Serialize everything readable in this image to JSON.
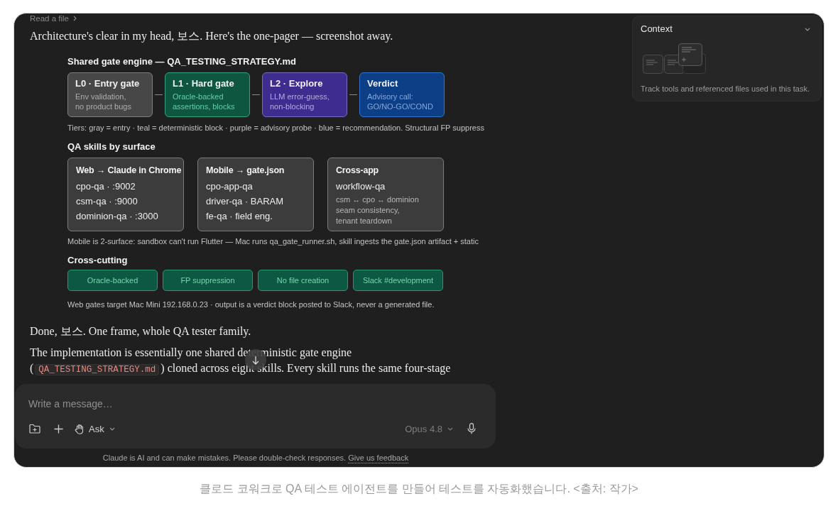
{
  "tool_use": {
    "label": "Read a file"
  },
  "intro": "Architecture's clear in my head, 보스. Here's the one-pager — screenshot away.",
  "diagram": {
    "sections": [
      {
        "kind": "pipeline",
        "title": "Shared gate engine — QA_TESTING_STRATEGY.md",
        "stages": [
          {
            "name": "L0 · Entry gate",
            "detail": [
              "Env validation,",
              "no product bugs"
            ],
            "color": "#474747"
          },
          {
            "name": "L1 · Hard gate",
            "detail": [
              "Oracle-backed",
              "assertions, blocks"
            ],
            "color": "#0e5640"
          },
          {
            "name": "L2 · Explore",
            "detail": [
              "LLM error-guess,",
              "non-blocking"
            ],
            "color": "#3e2c8e"
          },
          {
            "name": "Verdict",
            "detail": [
              "Advisory call:",
              "GO/NO-GO/COND"
            ],
            "color": "#0d3f86"
          }
        ],
        "note": "Tiers: gray = entry · teal = deterministic block · purple = advisory probe · blue = recommendation. Structural FP suppress"
      },
      {
        "kind": "cards",
        "title": "QA skills by surface",
        "cards": [
          {
            "title": "Web → Claude in Chrome",
            "lines": [
              {
                "kind": "main",
                "text": "cpo-qa · :9002"
              },
              {
                "kind": "main",
                "text": "csm-qa · :9000"
              },
              {
                "kind": "main",
                "text": "dominion-qa · :3000"
              }
            ]
          },
          {
            "title": "Mobile → gate.json",
            "lines": [
              {
                "kind": "main",
                "text": "cpo-app-qa"
              },
              {
                "kind": "main",
                "text": "driver-qa · BARAM"
              },
              {
                "kind": "main",
                "text": "fe-qa · field eng."
              }
            ]
          },
          {
            "title": "Cross-app",
            "lines": [
              {
                "kind": "main",
                "text": "workflow-qa"
              },
              {
                "kind": "sub",
                "text": "csm ↔ cpo ↔ dominion"
              },
              {
                "kind": "sub",
                "text": "seam consistency,"
              },
              {
                "kind": "sub",
                "text": "tenant teardown"
              }
            ]
          }
        ],
        "note": "Mobile is 2-surface: sandbox can't run Flutter — Mac runs qa_gate_runner.sh, skill ingests the gate.json artifact + static"
      },
      {
        "kind": "chips",
        "title": "Cross-cutting",
        "chips": [
          "Oracle-backed",
          "FP suppression",
          "No file creation",
          "Slack #development"
        ],
        "note": "Web gates target Mac Mini 192.168.0.23 · output is a verdict block posted to Slack, never a generated file."
      }
    ]
  },
  "reply": {
    "lead": "Done, 보스. One frame, whole QA tester family.",
    "paragraph": [
      {
        "kind": "text",
        "text": "The implementation is essentially one shared deterministic gate engine ("
      },
      {
        "kind": "code",
        "text": "QA_TESTING_STRATEGY.md"
      },
      {
        "kind": "text",
        "text": ") cloned across eight skills. Every skill runs the same four-stage"
      }
    ]
  },
  "composer": {
    "placeholder": "Write a message…",
    "mode": "Ask",
    "model": "Opus 4.8"
  },
  "disclaimer": {
    "text": "Claude is AI and can make mistakes. Please double-check responses.",
    "link": "Give us feedback"
  },
  "context_panel": {
    "title": "Context",
    "description": "Track tools and referenced files used in this task."
  },
  "caption": "클로드 코워크로 QA 테스트 에이전트를 만들어 테스트를 자동화했습니다. <출처: 작가>"
}
